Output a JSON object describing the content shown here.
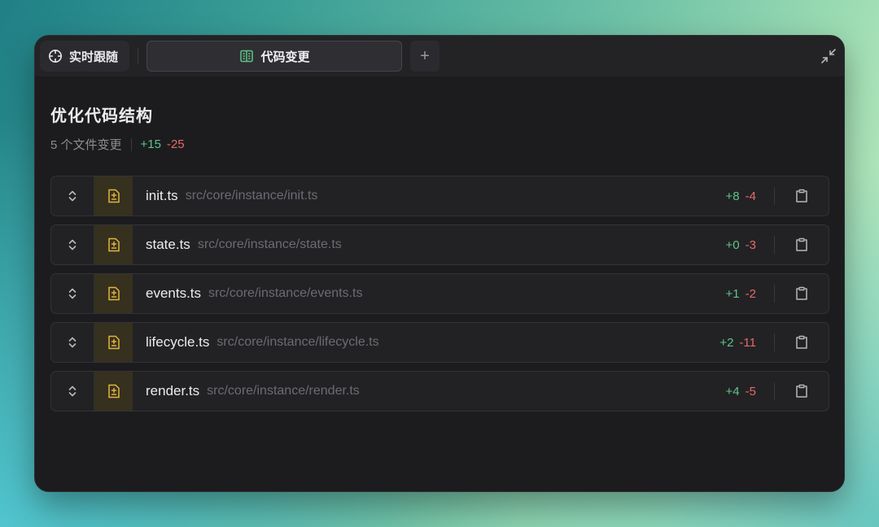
{
  "tabs": {
    "follow_label": "实时跟随",
    "changes_label": "代码变更",
    "add_label": "+"
  },
  "main": {
    "title": "优化代码结构",
    "file_count": "5 个文件变更",
    "added": "+15",
    "removed": "-25"
  },
  "files": [
    {
      "name": "init.ts",
      "path": "src/core/instance/init.ts",
      "added": "+8",
      "removed": "-4"
    },
    {
      "name": "state.ts",
      "path": "src/core/instance/state.ts",
      "added": "+0",
      "removed": "-3"
    },
    {
      "name": "events.ts",
      "path": "src/core/instance/events.ts",
      "added": "+1",
      "removed": "-2"
    },
    {
      "name": "lifecycle.ts",
      "path": "src/core/instance/lifecycle.ts",
      "added": "+2",
      "removed": "-11"
    },
    {
      "name": "render.ts",
      "path": "src/core/instance/render.ts",
      "added": "+4",
      "removed": "-5"
    }
  ],
  "icons": {
    "follow": "crosshair-icon",
    "changes": "book-icon",
    "collapse": "collapse-icon",
    "expand": "chevron-up-down-icon",
    "file": "file-diff-icon",
    "clipboard": "clipboard-icon"
  },
  "colors": {
    "added": "#5ec48a",
    "removed": "#e46a65",
    "file_icon": "#e0b53c",
    "tab_icon": "#5ec48a"
  }
}
